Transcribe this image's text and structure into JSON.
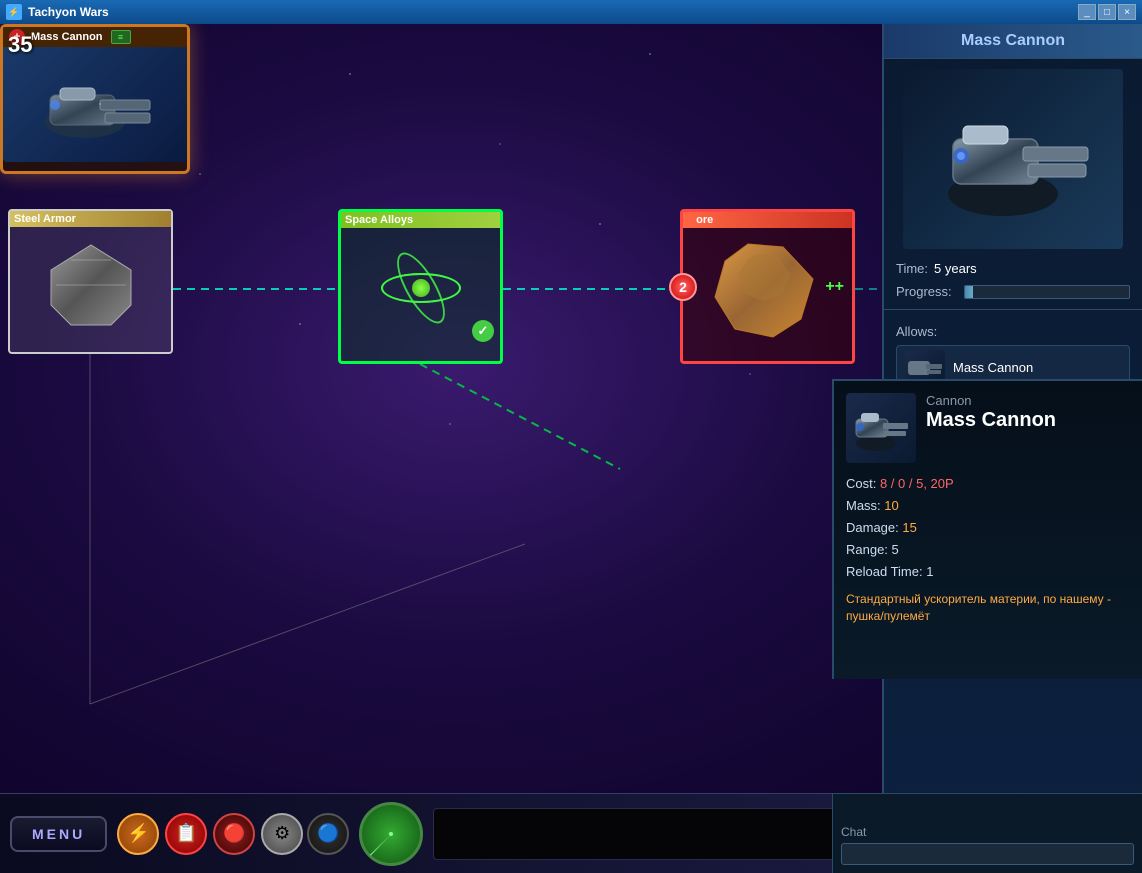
{
  "window": {
    "title": "Tachyon Wars",
    "minimize": "_",
    "maximize": "□",
    "close": "×"
  },
  "game": {
    "turn": "35"
  },
  "nodes": {
    "steel_armor": {
      "title": "Steel Armor"
    },
    "space_alloys": {
      "title": "Space Alloys",
      "researched": true
    },
    "ore": {
      "title": "ore",
      "badge_number": "2"
    },
    "mass_cannon": {
      "title": "Mass Cannon",
      "plus_label": "+",
      "green_label": "≡"
    }
  },
  "right_panel": {
    "title": "Mass Cannon",
    "time_label": "Time:",
    "time_value": "5 years",
    "progress_label": "Progress:",
    "allows_label": "Allows:",
    "allows_item": "Mass Cannon"
  },
  "weapon_panel": {
    "type": "Cannon",
    "name": "Mass Cannon",
    "cost_label": "Cost:",
    "cost_value": "8 / 0 / 5, 20P",
    "mass_label": "Mass:",
    "mass_value": "10",
    "damage_label": "Damage:",
    "damage_value": "15",
    "range_label": "Range:",
    "range_value": "5",
    "reload_label": "Reload Time:",
    "reload_value": "1",
    "description": "Стандартный ускоритель материи, по нашему - пушка/пулемёт"
  },
  "bottom": {
    "menu_label": "MENU",
    "chat_label": "Chat"
  }
}
